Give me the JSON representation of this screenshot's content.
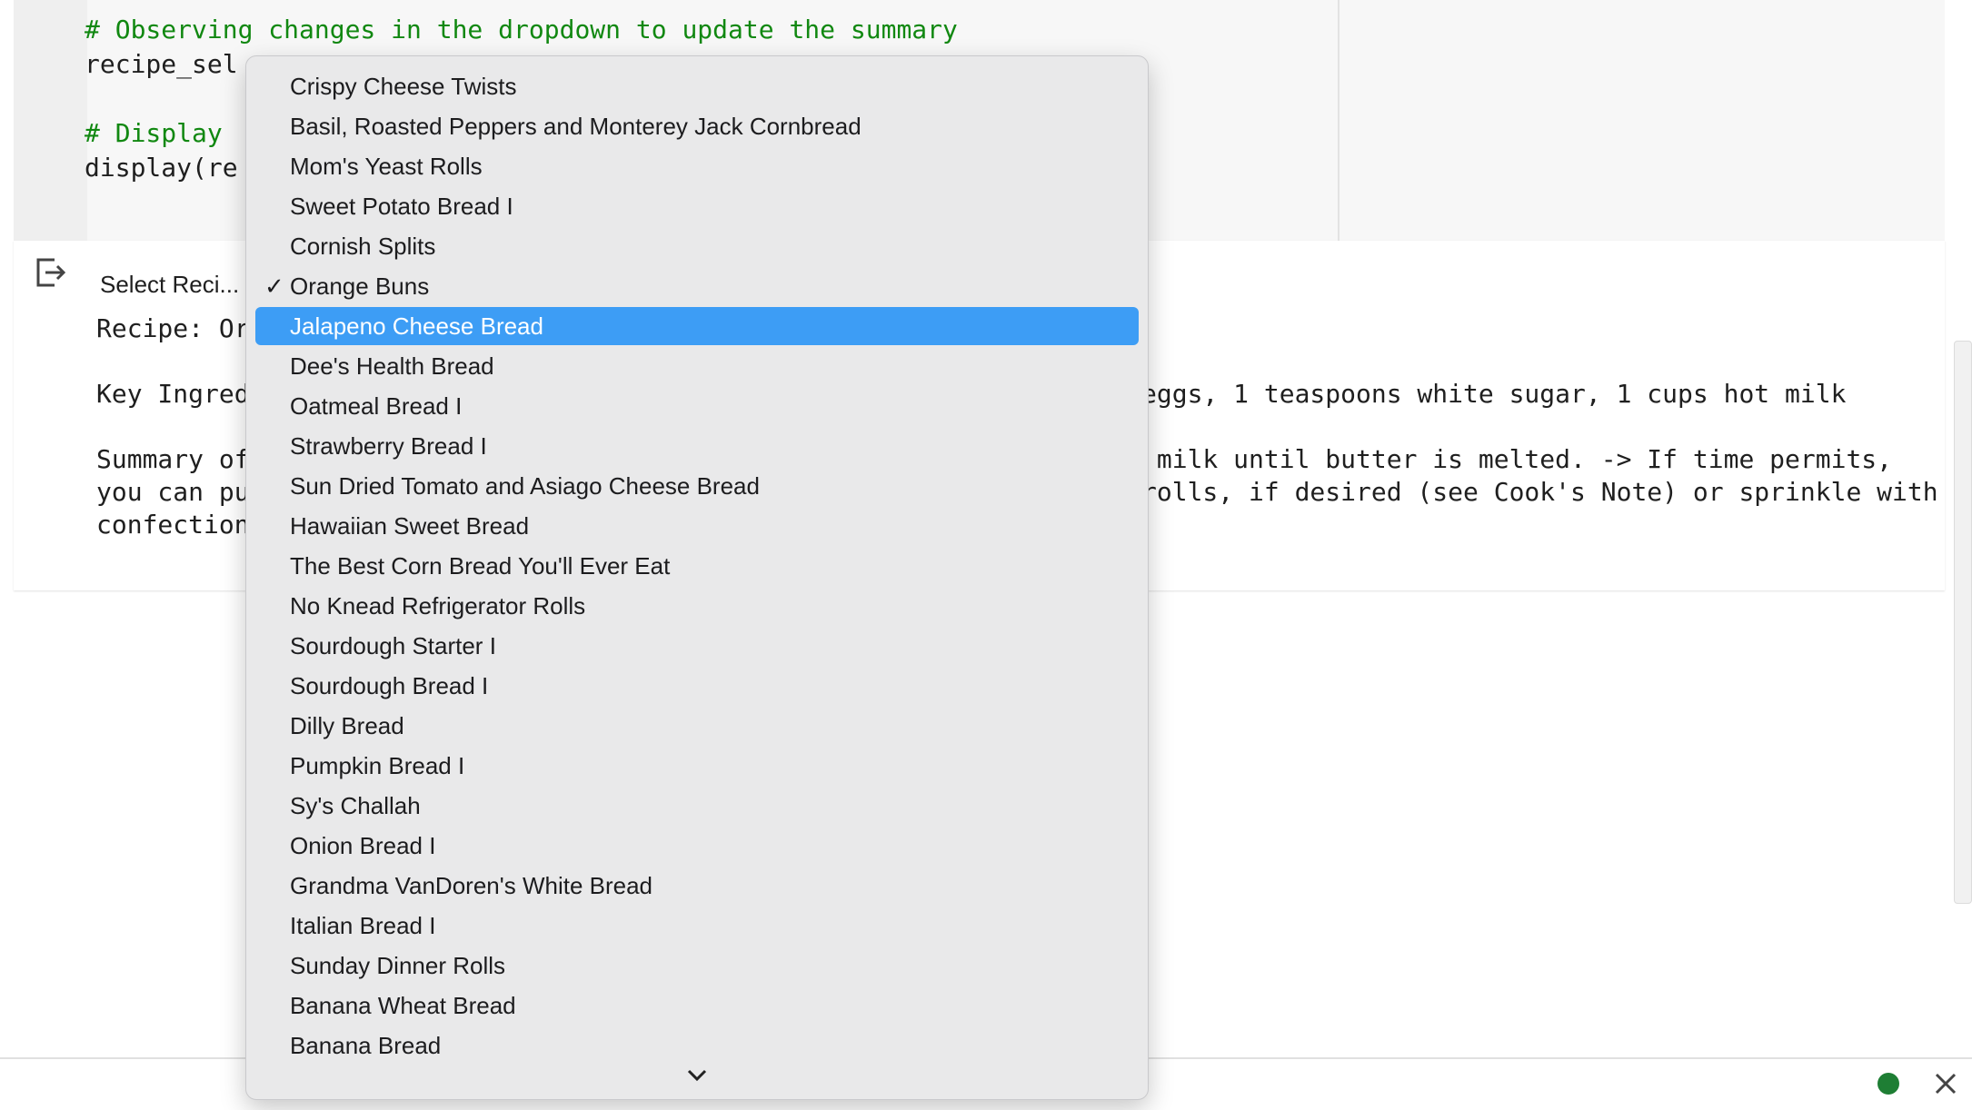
{
  "code": {
    "comment1": "# Observing changes in the dropdown to update the summary",
    "line2": "recipe_sel",
    "comment2": "# Display ",
    "line4_prefix": "display(",
    "line4_rest": "re"
  },
  "output": {
    "widget_label": "Select Reci...",
    "recipe_line": "Recipe: Or",
    "key_line_left": "Key Ingred",
    "key_line_right": "eggs, 1 teaspoons white sugar, 1 cups hot milk",
    "summary_line1_left": "Summary of",
    "summary_line1_right": " milk until butter is melted. -> If time permits,",
    "summary_line2_left": "you can pu",
    "summary_line2_right": "rolls, if desired (see Cook's Note) or sprinkle with",
    "summary_line3_left": "confection"
  },
  "dropdown": {
    "selected": "Orange Buns",
    "highlighted": "Jalapeno Cheese Bread",
    "check_glyph": "✓",
    "options": [
      "Crispy Cheese Twists",
      "Basil, Roasted Peppers and Monterey Jack Cornbread",
      "Mom's Yeast Rolls",
      "Sweet Potato Bread I",
      "Cornish Splits",
      "Orange Buns",
      "Jalapeno Cheese Bread",
      "Dee's Health Bread",
      "Oatmeal Bread I",
      "Strawberry Bread I",
      "Sun Dried Tomato and Asiago Cheese Bread",
      "Hawaiian Sweet Bread",
      "The Best Corn Bread You'll Ever Eat",
      "No Knead Refrigerator Rolls",
      "Sourdough Starter I",
      "Sourdough Bread I",
      "Dilly Bread",
      "Pumpkin Bread I",
      "Sy's Challah",
      "Onion Bread I",
      "Grandma VanDoren's White Bread",
      "Italian Bread I",
      "Sunday Dinner Rolls",
      "Banana Wheat Bread",
      "Banana Bread"
    ]
  },
  "icons": {
    "output_icon": "output-exit-icon",
    "scroll_down": "chevron-down-icon",
    "close": "close-icon",
    "status": "status-dot"
  },
  "colors": {
    "highlight": "#3d9df5",
    "comment": "#118811",
    "status_green": "#1e7e34"
  }
}
